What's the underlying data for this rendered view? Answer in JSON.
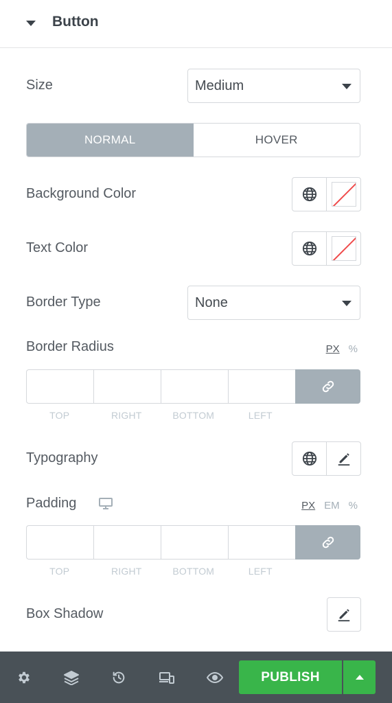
{
  "section": {
    "title": "Button"
  },
  "size": {
    "label": "Size",
    "value": "Medium"
  },
  "state_tabs": {
    "normal": "NORMAL",
    "hover": "HOVER",
    "active": "normal"
  },
  "background_color": {
    "label": "Background Color"
  },
  "text_color": {
    "label": "Text Color"
  },
  "border_type": {
    "label": "Border Type",
    "value": "None"
  },
  "border_radius": {
    "label": "Border Radius",
    "units": [
      "PX",
      "%"
    ],
    "active_unit": "PX",
    "sides": [
      "TOP",
      "RIGHT",
      "BOTTOM",
      "LEFT"
    ]
  },
  "typography": {
    "label": "Typography"
  },
  "padding": {
    "label": "Padding",
    "units": [
      "PX",
      "EM",
      "%"
    ],
    "active_unit": "PX",
    "sides": [
      "TOP",
      "RIGHT",
      "BOTTOM",
      "LEFT"
    ]
  },
  "box_shadow": {
    "label": "Box Shadow"
  },
  "footer": {
    "icons": [
      "settings-icon",
      "layers-icon",
      "history-icon",
      "responsive-icon",
      "preview-icon"
    ],
    "publish_label": "PUBLISH"
  },
  "colors": {
    "accent_active": "#a4afb7",
    "publish_green": "#39b54a",
    "footer_bg": "#495157",
    "swatch_slash": "#ef4a4a"
  }
}
